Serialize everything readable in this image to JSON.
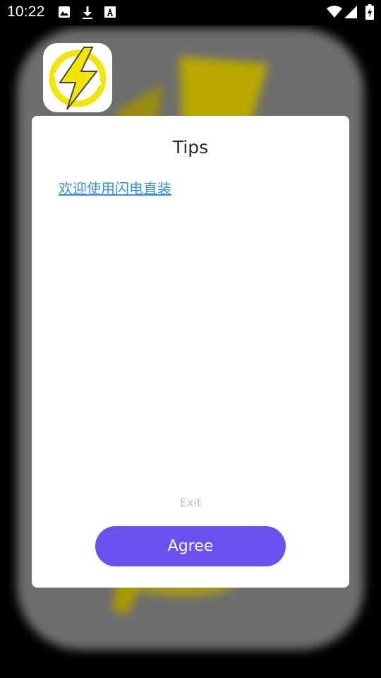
{
  "status_bar": {
    "time": "10:22",
    "left_icons": [
      "image-icon",
      "download-icon",
      "font-a-icon"
    ],
    "right_icons": [
      "wifi-icon",
      "signal-icon",
      "battery-charging-icon"
    ]
  },
  "app": {
    "icon": "lightning-bolt-icon",
    "icon_color": "#f2e600"
  },
  "dialog": {
    "title": "Tips",
    "link_text": "欢迎使用闪电直装",
    "exit_label": "Exit",
    "agree_label": "Agree",
    "accent_color": "#6b4ff0",
    "link_color": "#3b8fe0"
  }
}
